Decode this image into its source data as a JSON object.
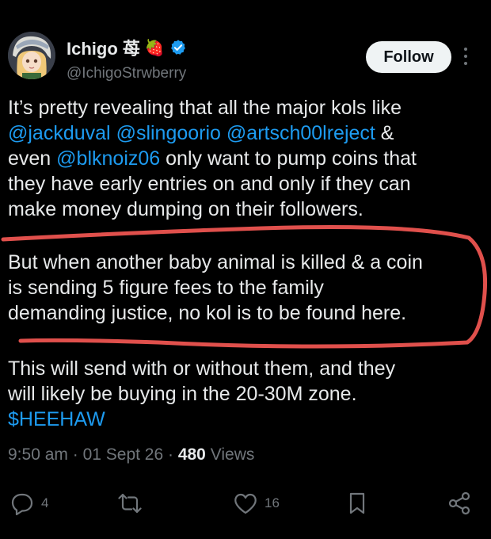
{
  "author": {
    "display_name": "Ichigo 苺",
    "emoji": "🍓",
    "verified_icon": "verified-badge-icon",
    "handle": "@IchigoStrwberry",
    "avatar_icon": "anime-avatar"
  },
  "follow_label": "Follow",
  "tweet": {
    "p1": {
      "l1_text": "It’s pretty revealing that all the major kols like",
      "l2_m1": "@jackduval",
      "l2_m2": "@slingoorio",
      "l2_m3": "@artsch00lreject",
      "l2_tail": " &",
      "l3_pre": "even ",
      "l3_m": "@blknoiz06",
      "l3_tail": " only want to pump coins that",
      "l4": "they have early entries on and only if they can",
      "l5": "make money dumping on their followers."
    },
    "p2": {
      "l1": "But when another baby animal is killed & a coin",
      "l2": "is sending 5 figure fees to the family",
      "l3": "demanding justice, no kol is to be found here."
    },
    "p3": {
      "l1": "This will send with or without them, and they",
      "l2": "will likely be buying in the 20-30M zone.",
      "l3": "$HEEHAW"
    }
  },
  "meta": {
    "time": "9:50 am",
    "date": "01 Sept 26",
    "views_count": "480",
    "views_label": "Views"
  },
  "actions": {
    "replies": "4",
    "likes": "16"
  },
  "colors": {
    "background": "#000000",
    "text": "#e7e9ea",
    "link": "#1d9bf0",
    "muted": "#71767b",
    "highlight": "#e0504c"
  }
}
